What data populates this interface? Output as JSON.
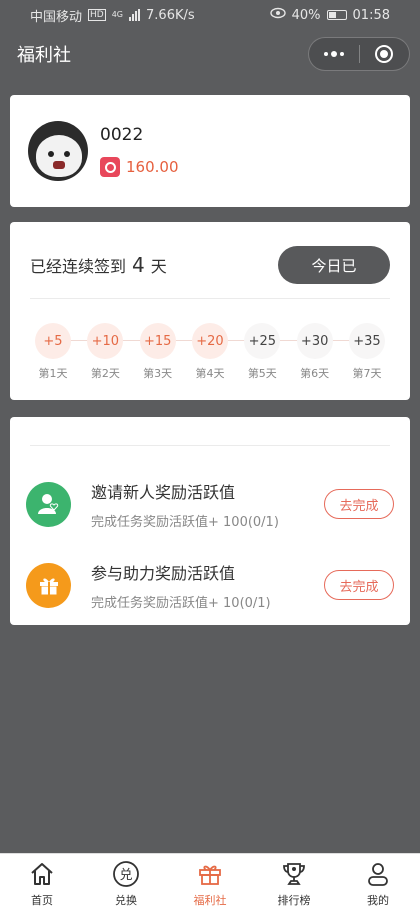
{
  "status_bar": {
    "carrier": "中国移动",
    "network_badge": "HD",
    "network_type": "4G",
    "speed": "7.66K/s",
    "battery": "40%",
    "time": "01:58"
  },
  "nav": {
    "title": "福利社"
  },
  "profile": {
    "name": "0022",
    "points": "160.00"
  },
  "signin": {
    "prefix": "已经连续签到",
    "days": "4",
    "suffix": "天",
    "today_button": "今日已",
    "items": [
      {
        "value": "+5",
        "label": "第1天",
        "done": true
      },
      {
        "value": "+10",
        "label": "第2天",
        "done": true
      },
      {
        "value": "+15",
        "label": "第3天",
        "done": true
      },
      {
        "value": "+20",
        "label": "第4天",
        "done": true
      },
      {
        "value": "+25",
        "label": "第5天",
        "done": false
      },
      {
        "value": "+30",
        "label": "第6天",
        "done": false
      },
      {
        "value": "+35",
        "label": "第7天",
        "done": false
      }
    ]
  },
  "tasks": [
    {
      "title": "邀请新人奖励活跃值",
      "desc": "完成任务奖励活跃值+ 100(0/1)",
      "button": "去完成",
      "icon": "user-icon",
      "color": "#3cb46e"
    },
    {
      "title": "参与助力奖励活跃值",
      "desc": "完成任务奖励活跃值+ 10(0/1)",
      "button": "去完成",
      "icon": "gift-icon",
      "color": "#f59a1b"
    }
  ],
  "tabbar": {
    "items": [
      {
        "label": "首页",
        "icon": "home-icon"
      },
      {
        "label": "兑换",
        "icon": "exchange-icon",
        "glyph": "兑"
      },
      {
        "label": "福利社",
        "icon": "gift-icon",
        "active": true
      },
      {
        "label": "排行榜",
        "icon": "trophy-icon"
      },
      {
        "label": "我的",
        "icon": "person-icon"
      }
    ]
  },
  "colors": {
    "accent": "#e56a45",
    "background": "#5b5c5e",
    "done_dot": "#fdece7"
  }
}
